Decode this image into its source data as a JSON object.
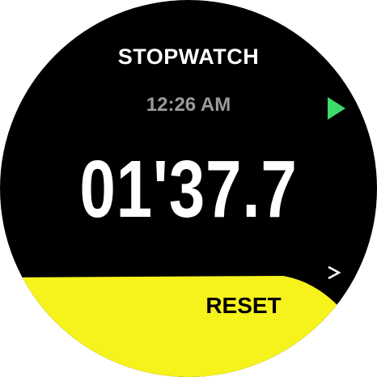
{
  "screen": {
    "title": "STOPWATCH",
    "clock_time": "12:26 AM",
    "elapsed_time": "01'37.7",
    "reset_label": "RESET"
  },
  "icons": {
    "start": "play-icon",
    "next": "chevron-right-icon"
  },
  "colors": {
    "background": "#000000",
    "primary_text": "#ffffff",
    "secondary_text": "#9a9a9a",
    "accent_green": "#3dd96a",
    "reset_yellow": "#f6f21c"
  }
}
